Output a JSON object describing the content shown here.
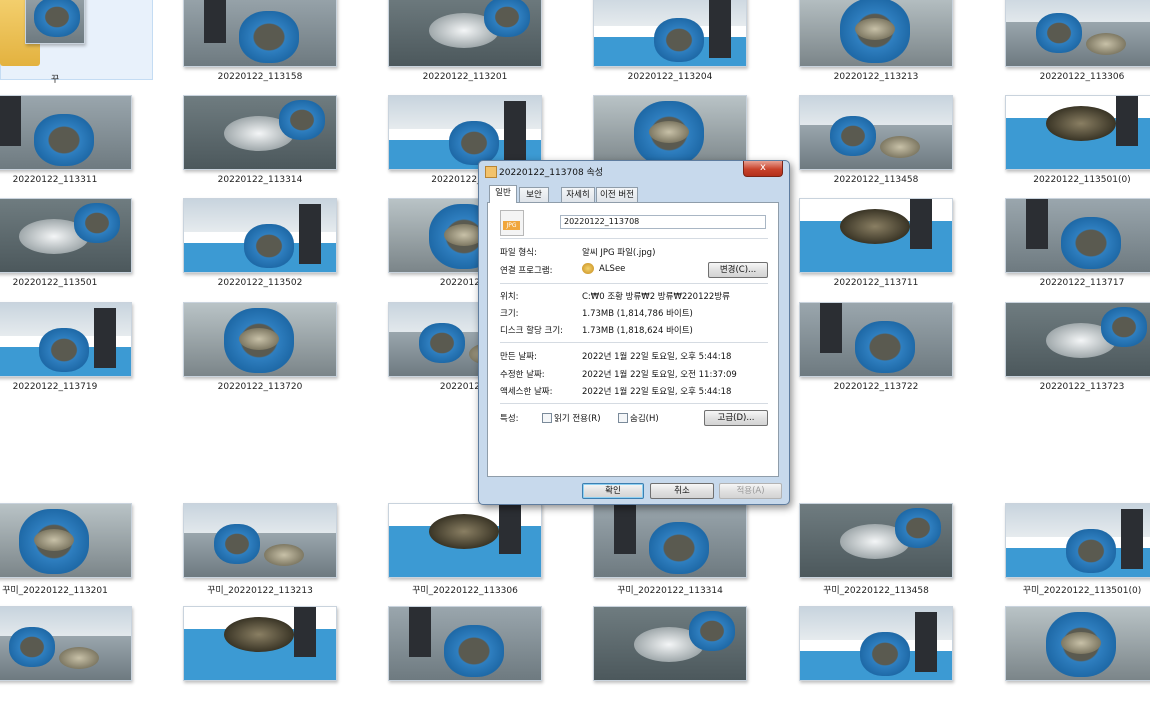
{
  "explorer": {
    "thumbnails": [
      {
        "caption": "꾸",
        "kind": "folder"
      },
      {
        "caption": "20220122_113158"
      },
      {
        "caption": "20220122_113201"
      },
      {
        "caption": "20220122_113204"
      },
      {
        "caption": "20220122_113213"
      },
      {
        "caption": "20220122_113306"
      },
      {
        "caption": "20220122_113311"
      },
      {
        "caption": "20220122_113314"
      },
      {
        "caption": "20220122_113"
      },
      {
        "caption": ""
      },
      {
        "caption": "20220122_113458"
      },
      {
        "caption": "20220122_113501(0)"
      },
      {
        "caption": "20220122_113501"
      },
      {
        "caption": "20220122_113502"
      },
      {
        "caption": "20220122_"
      },
      {
        "caption": ""
      },
      {
        "caption": "20220122_113711"
      },
      {
        "caption": "20220122_113717"
      },
      {
        "caption": "20220122_113719"
      },
      {
        "caption": "20220122_113720"
      },
      {
        "caption": "20220122_"
      },
      {
        "caption": ""
      },
      {
        "caption": "20220122_113722"
      },
      {
        "caption": "20220122_113723"
      },
      {
        "caption": "꾸미_20220122_113201"
      },
      {
        "caption": "꾸미_20220122_113213"
      },
      {
        "caption": "꾸미_20220122_113306"
      },
      {
        "caption": "꾸미_20220122_113314"
      },
      {
        "caption": "꾸미_20220122_113458"
      },
      {
        "caption": "꾸미_20220122_113501(0)"
      },
      {
        "caption": ""
      },
      {
        "caption": ""
      },
      {
        "caption": ""
      },
      {
        "caption": ""
      },
      {
        "caption": ""
      },
      {
        "caption": ""
      }
    ]
  },
  "dialog": {
    "title": "20220122_113708 속성",
    "close_label": "x",
    "tabs": [
      "일반",
      "보안",
      "자세히",
      "이전 버전"
    ],
    "active_tab": "일반",
    "file_icon_text": "JPG",
    "file_name": "20220122_113708",
    "type_label": "파일 형식:",
    "type_value": "알씨 JPG 파일(.jpg)",
    "opens_with_label": "연결 프로그램:",
    "opens_with_value": "ALSee",
    "change_button": "변경(C)...",
    "location_label": "위치:",
    "location_value": "C:₩0 조황 방류₩2 방류₩220122방류",
    "size_label": "크기:",
    "size_value": "1.73MB (1,814,786 바이트)",
    "size_on_disk_label": "디스크 할당 크기:",
    "size_on_disk_value": "1.73MB (1,818,624 바이트)",
    "created_label": "만든 날짜:",
    "created_value": "2022년 1월 22일 토요일, 오후 5:44:18",
    "modified_label": "수정한 날짜:",
    "modified_value": "2022년 1월 22일 토요일, 오전 11:37:09",
    "accessed_label": "액세스한 날짜:",
    "accessed_value": "2022년 1월 22일 토요일, 오후 5:44:18",
    "attributes_label": "특성:",
    "readonly_label": "읽기 전용(R)",
    "hidden_label": "숨김(H)",
    "advanced_button": "고급(D)...",
    "ok_button": "확인",
    "cancel_button": "취소",
    "apply_button": "적용(A)"
  }
}
